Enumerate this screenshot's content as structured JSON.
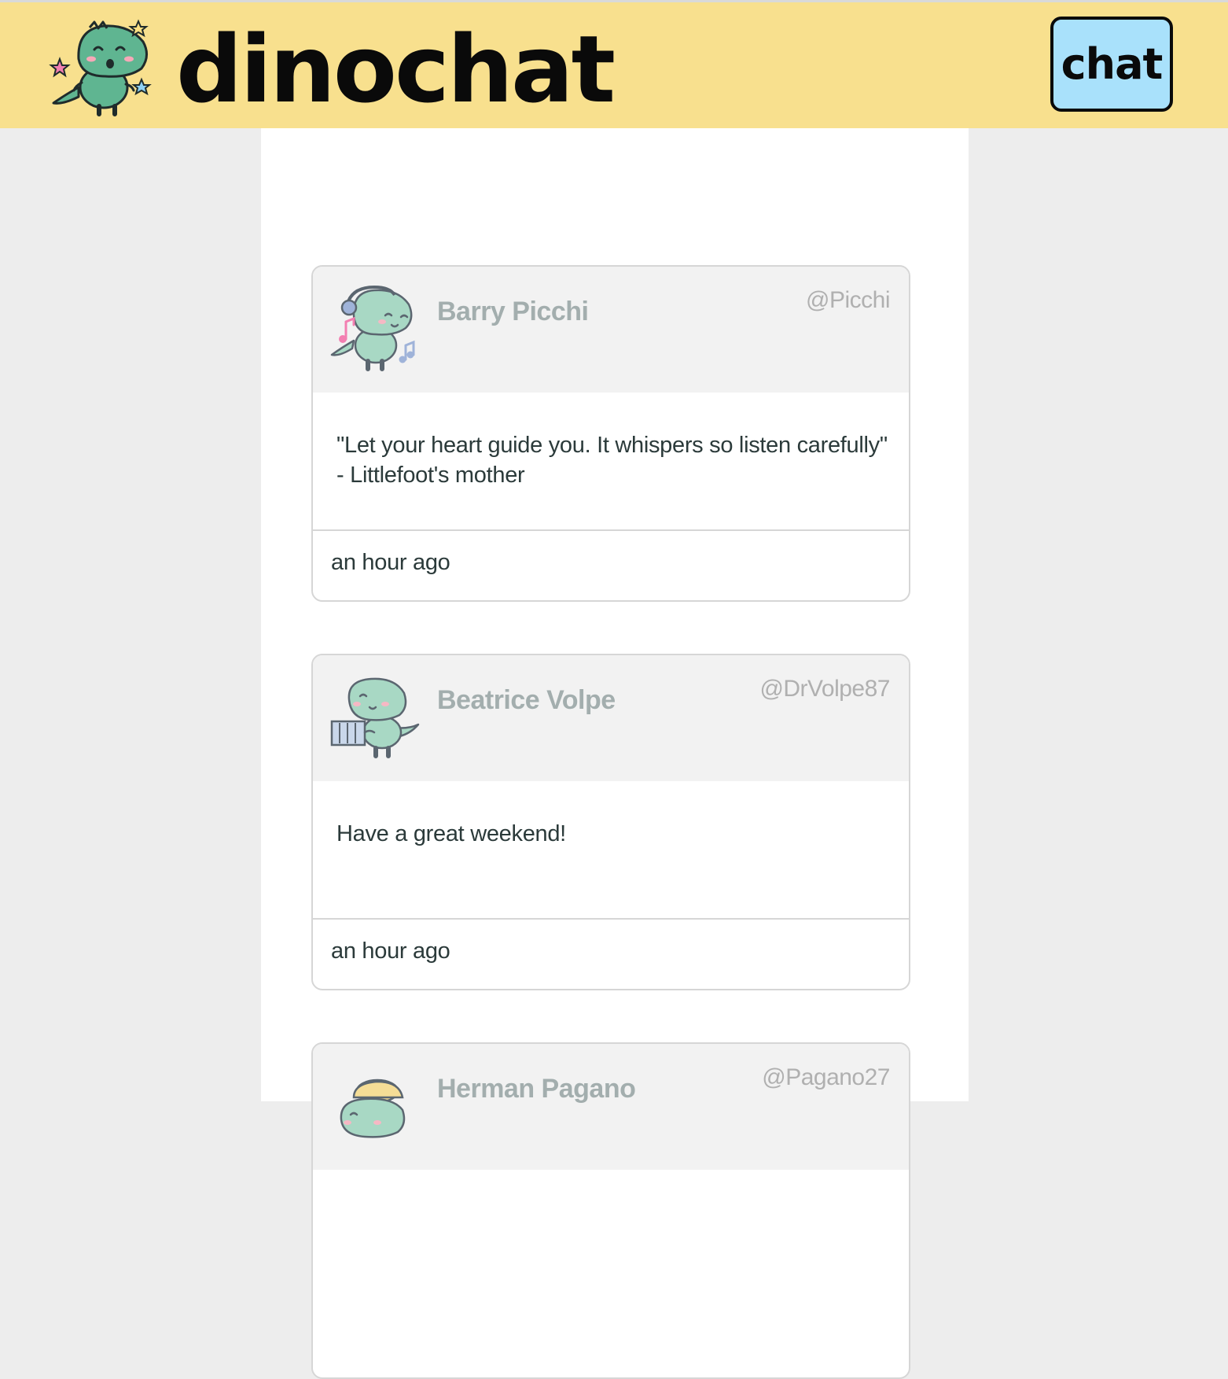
{
  "app": {
    "brand": "dinochat",
    "nav_button_label": "chat"
  },
  "colors": {
    "navbar": "#f8e08e",
    "chat_button": "#a9e1fb",
    "card_header": "#f2f2f2",
    "name_text": "#a3aeae",
    "body_text": "#2b3a3a"
  },
  "posts": [
    {
      "name": "Barry Picchi",
      "handle": "@Picchi",
      "avatar_icon": "dino-headphones-icon",
      "body_lines": [
        "\"Let your heart guide you. It whispers so listen carefully\"",
        "- Littlefoot's mother"
      ],
      "time": "an hour ago"
    },
    {
      "name": "Beatrice Volpe",
      "handle": "@DrVolpe87",
      "avatar_icon": "dino-bookshelf-icon",
      "body_lines": [
        "Have a great weekend!"
      ],
      "time": "an hour ago"
    },
    {
      "name": "Herman Pagano",
      "handle": "@Pagano27",
      "avatar_icon": "dino-hat-icon",
      "body_lines": [],
      "time": ""
    }
  ]
}
